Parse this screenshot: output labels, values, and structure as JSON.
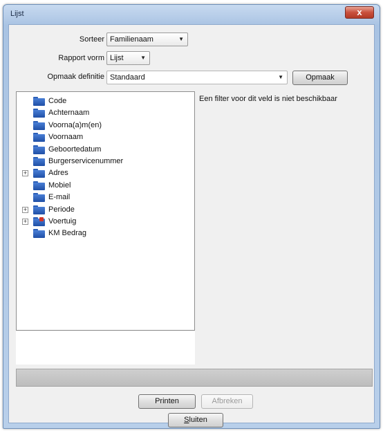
{
  "window": {
    "title": "Lijst",
    "close_glyph": "x"
  },
  "form": {
    "sorteer_label": "Sorteer",
    "sorteer_value": "Familienaam",
    "rapport_vorm_label": "Rapport vorm",
    "rapport_vorm_value": "Lijst",
    "opmaak_definitie_label": "Opmaak definitie",
    "opmaak_definitie_value": "Standaard",
    "opmaak_button": "Opmaak"
  },
  "tree": {
    "items": [
      {
        "label": "Code",
        "expandable": false,
        "icon": "folder-icon"
      },
      {
        "label": "Achternaam",
        "expandable": false,
        "icon": "folder-icon"
      },
      {
        "label": "Voorna(a)m(en)",
        "expandable": false,
        "icon": "folder-icon"
      },
      {
        "label": "Voornaam",
        "expandable": false,
        "icon": "folder-icon"
      },
      {
        "label": "Geboortedatum",
        "expandable": false,
        "icon": "folder-icon"
      },
      {
        "label": "Burgerservicenummer",
        "expandable": false,
        "icon": "folder-icon"
      },
      {
        "label": "Adres",
        "expandable": true,
        "icon": "folder-icon"
      },
      {
        "label": "Mobiel",
        "expandable": false,
        "icon": "folder-icon"
      },
      {
        "label": "E-mail",
        "expandable": false,
        "icon": "folder-icon"
      },
      {
        "label": "Periode",
        "expandable": true,
        "icon": "folder-icon"
      },
      {
        "label": "Voertuig",
        "expandable": true,
        "icon": "folder-marked-icon"
      },
      {
        "label": "KM Bedrag",
        "expandable": false,
        "icon": "folder-icon"
      }
    ]
  },
  "filter_message": "Een filter voor dit veld is niet beschikbaar",
  "buttons": {
    "printen": "Printen",
    "afbreken": "Afbreken",
    "sluiten_prefix": "",
    "sluiten_underlined": "S",
    "sluiten_rest": "luiten"
  }
}
